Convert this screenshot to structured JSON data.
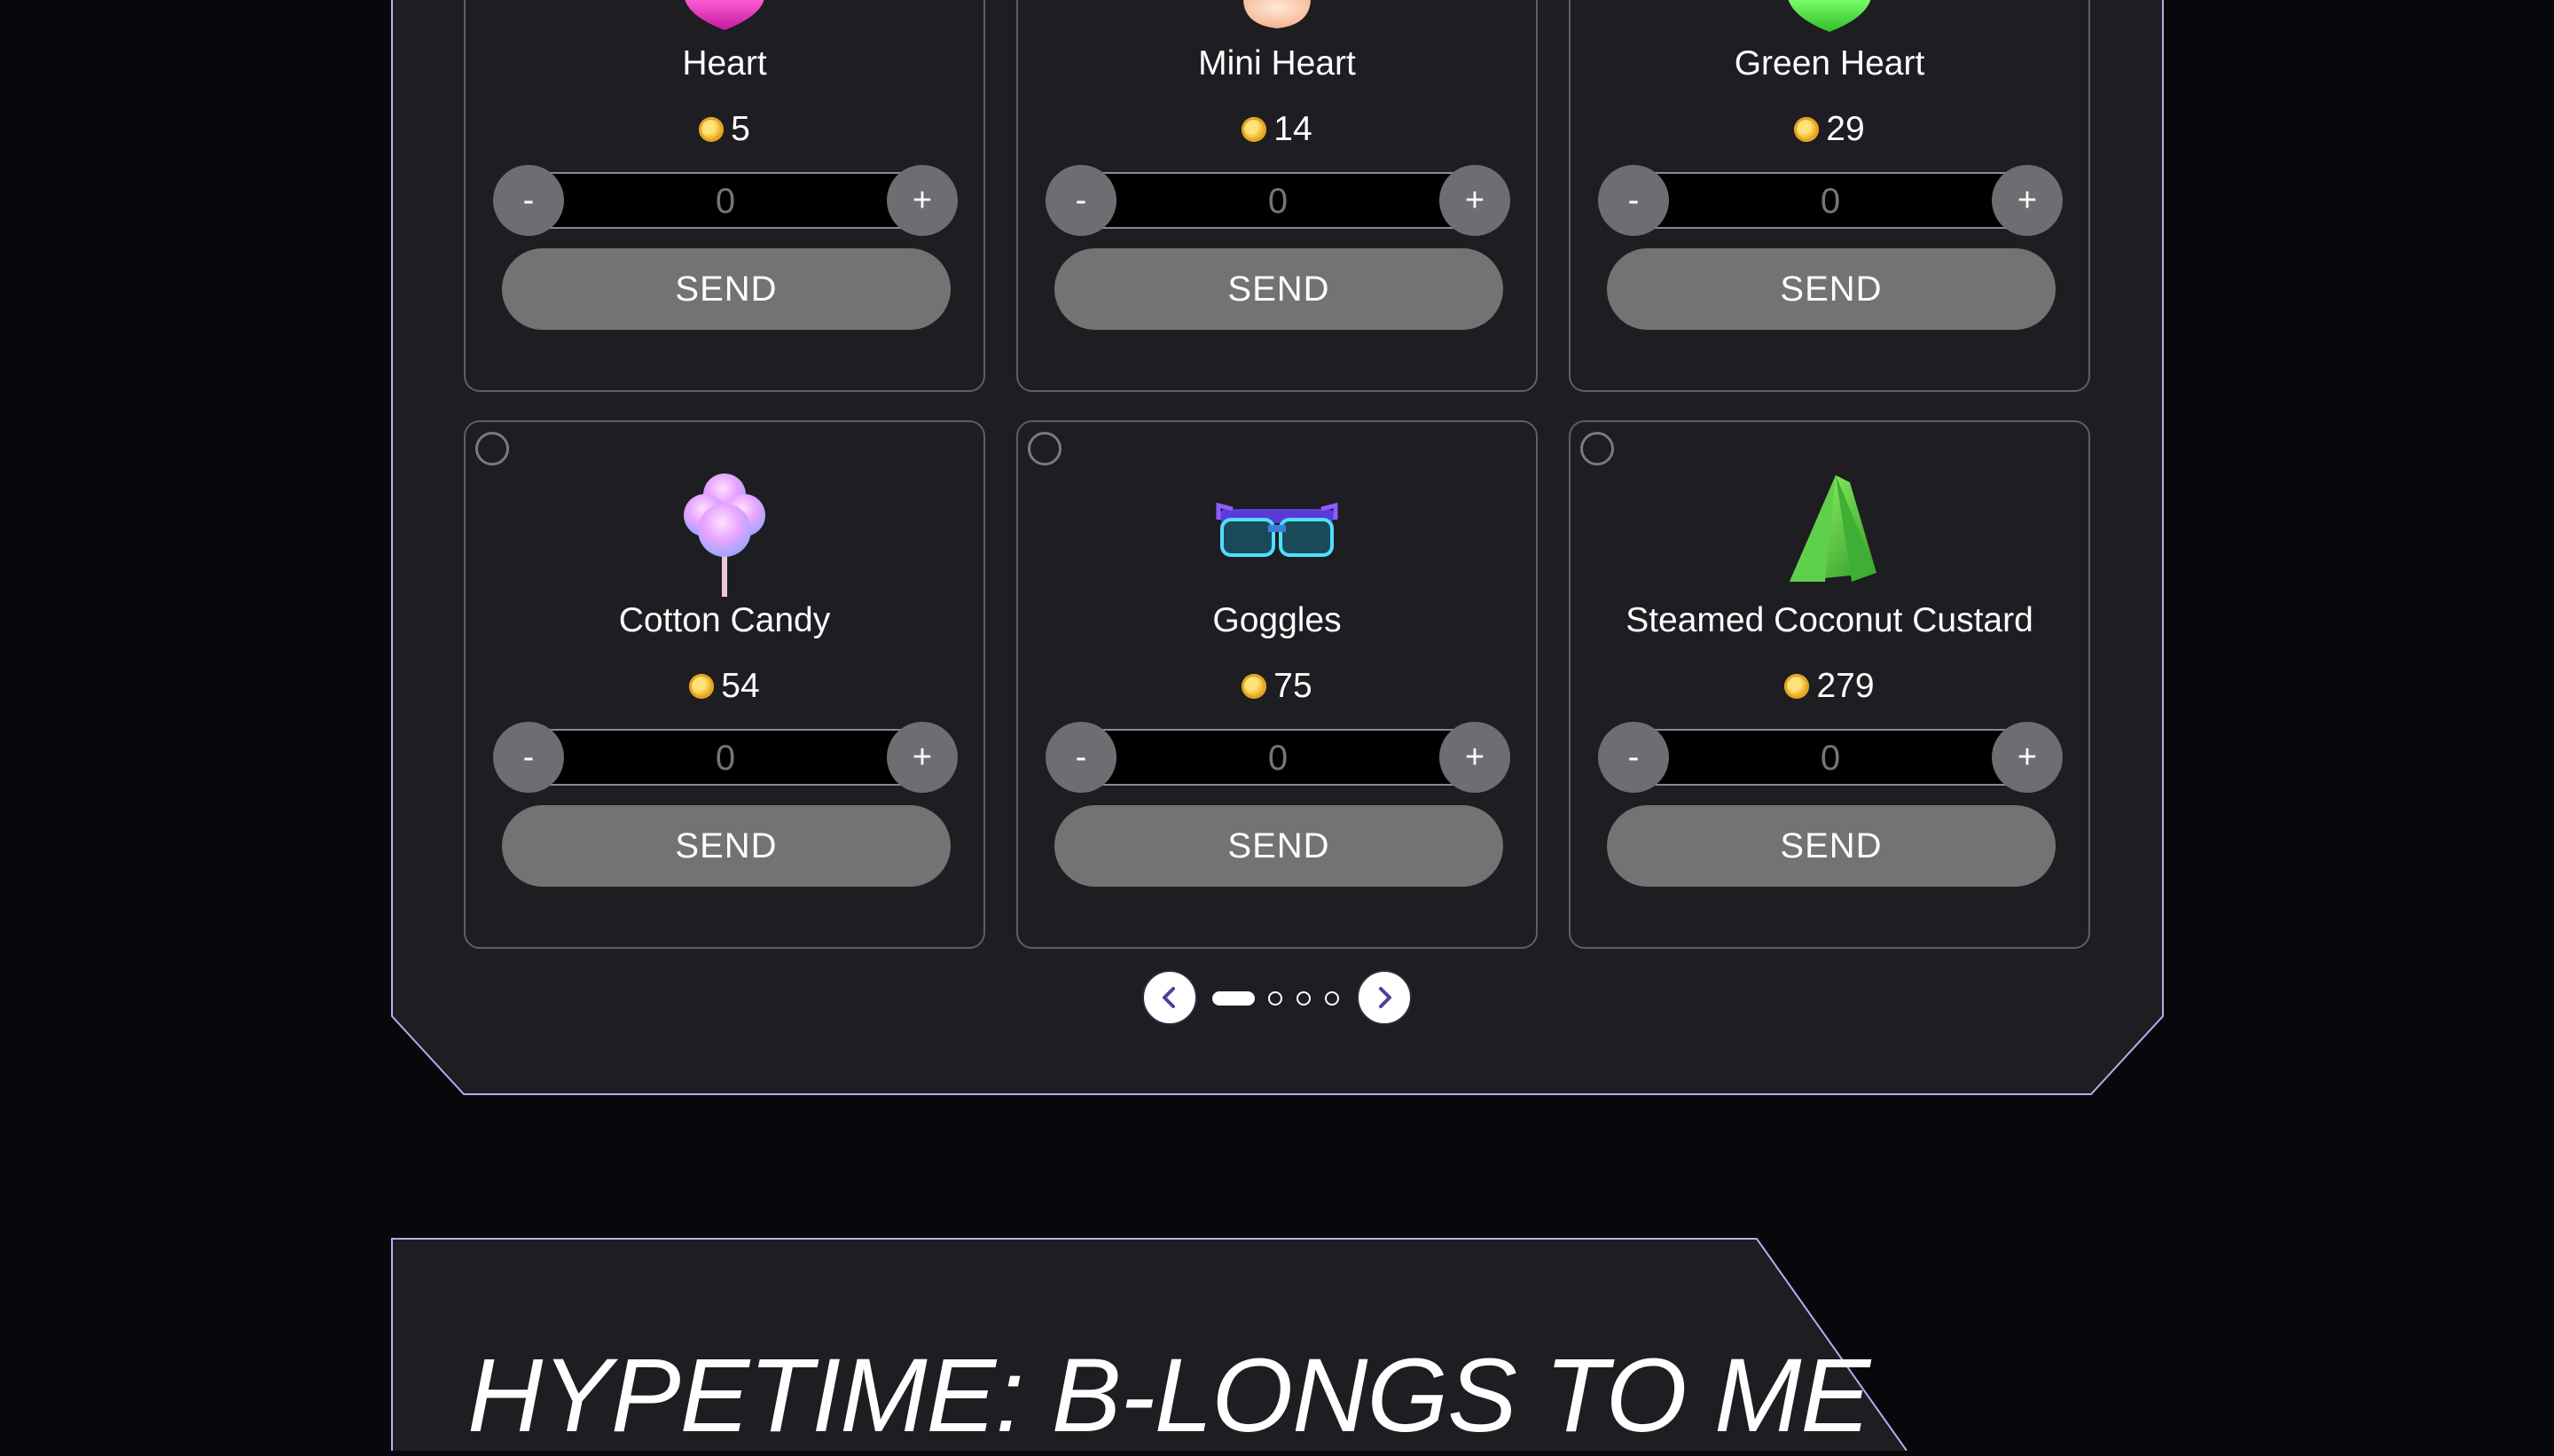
{
  "colors": {
    "background": "#07070c",
    "panel": "#1d1d22",
    "panel_border": "#b3aef0",
    "card_border": "#5e5e66",
    "button_gray": "#737373",
    "accent": "#4b3fa0"
  },
  "gifts": [
    {
      "name": "Heart",
      "price": "5",
      "quantity_placeholder": "0",
      "send_label": "SEND",
      "minus_label": "-",
      "plus_label": "+",
      "icon": "pink-heart-icon"
    },
    {
      "name": "Mini Heart",
      "price": "14",
      "quantity_placeholder": "0",
      "send_label": "SEND",
      "minus_label": "-",
      "plus_label": "+",
      "icon": "peach-heart-icon"
    },
    {
      "name": "Green Heart",
      "price": "29",
      "quantity_placeholder": "0",
      "send_label": "SEND",
      "minus_label": "-",
      "plus_label": "+",
      "icon": "green-heart-icon"
    },
    {
      "name": "Cotton Candy",
      "price": "54",
      "quantity_placeholder": "0",
      "send_label": "SEND",
      "minus_label": "-",
      "plus_label": "+",
      "icon": "cotton-candy-icon"
    },
    {
      "name": "Goggles",
      "price": "75",
      "quantity_placeholder": "0",
      "send_label": "SEND",
      "minus_label": "-",
      "plus_label": "+",
      "icon": "goggles-icon"
    },
    {
      "name": "Steamed Coconut Custard",
      "price": "279",
      "quantity_placeholder": "0",
      "send_label": "SEND",
      "minus_label": "-",
      "plus_label": "+",
      "icon": "coconut-custard-icon"
    }
  ],
  "pagination": {
    "current_page": 1,
    "total_pages": 4
  },
  "hype_section": {
    "title": "HYPETIME: B-LONGS TO ME"
  }
}
